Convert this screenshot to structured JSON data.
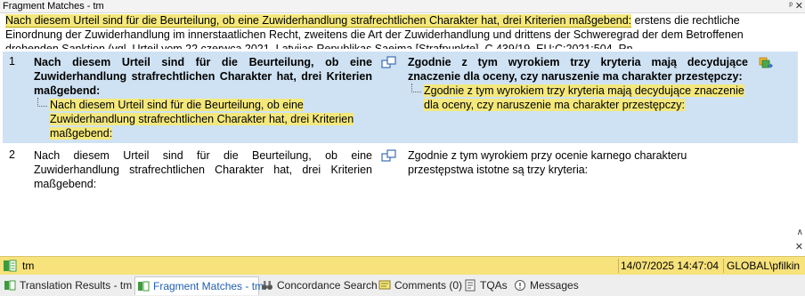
{
  "panel": {
    "title": "Fragment Matches - tm",
    "pin_glyph": "ᵖ",
    "close_glyph": "✕"
  },
  "source_context": {
    "highlighted": "Nach diesem Urteil sind für die Beurteilung, ob eine Zuwiderhandlung strafrechtlichen Charakter hat, drei Kriterien maßgebend:",
    "rest": " erstens die rechtliche Einordnung der Zuwiderhandlung im innerstaatlichen Recht, zweitens die Art der Zuwiderhandlung und drittens der Schweregrad der dem Betroffenen drohenden Sanktion (vgl. Urteil vom 22 czerwca 2021, Latvijas Republikas Saeima [Strafpunkte], C 439/19, EU:C:2021:504, Rn."
  },
  "matches": [
    {
      "index": "1",
      "source": "Nach diesem Urteil sind für die Beurteilung, ob eine Zuwiderhandlung strafrechtlichen Charakter hat, drei Kriterien maßgebend:",
      "source_fragment": "Nach diesem Urteil sind für die Beurteilung, ob eine Zuwiderhandlung strafrechtlichen Charakter hat, drei Kriterien maßgebend:",
      "target": "Zgodnie z tym wyrokiem trzy kryteria mają decydujące znaczenie dla oceny, czy naruszenie ma charakter przestępczy:",
      "target_fragment": "Zgodnie z tym wyrokiem trzy kryteria mają decydujące znaczenie dla oceny, czy naruszenie ma charakter przestępczy:"
    },
    {
      "index": "2",
      "source": "Nach diesem Urteil sind für die Beurteilung, ob eine Zuwiderhandlung strafrechtlichen Charakter hat, drei Kriterien maßgebend:",
      "target": "Zgodnie z tym wyrokiem przy ocenie karnego charakteru przestępstwa istotne są trzy kryteria:"
    }
  ],
  "status": {
    "tm_name": "tm",
    "date": "14/07/2025 14:47:04",
    "user": "GLOBAL\\pfilkin"
  },
  "tabs": [
    {
      "label": "Translation Results - tm",
      "icon": "translation-results-icon"
    },
    {
      "label": "Fragment Matches - tm",
      "icon": "fragment-matches-icon"
    },
    {
      "label": "Concordance Search",
      "icon": "binoculars-icon"
    },
    {
      "label": "Comments (0)",
      "icon": "comments-icon"
    },
    {
      "label": "TQAs",
      "icon": "tqa-icon"
    },
    {
      "label": "Messages",
      "icon": "messages-icon"
    }
  ],
  "colors": {
    "highlight": "#f4e87c",
    "selected_row": "#cfe2f3",
    "status_bar": "#f7e27c",
    "active_tab_text": "#1f5fb0"
  }
}
